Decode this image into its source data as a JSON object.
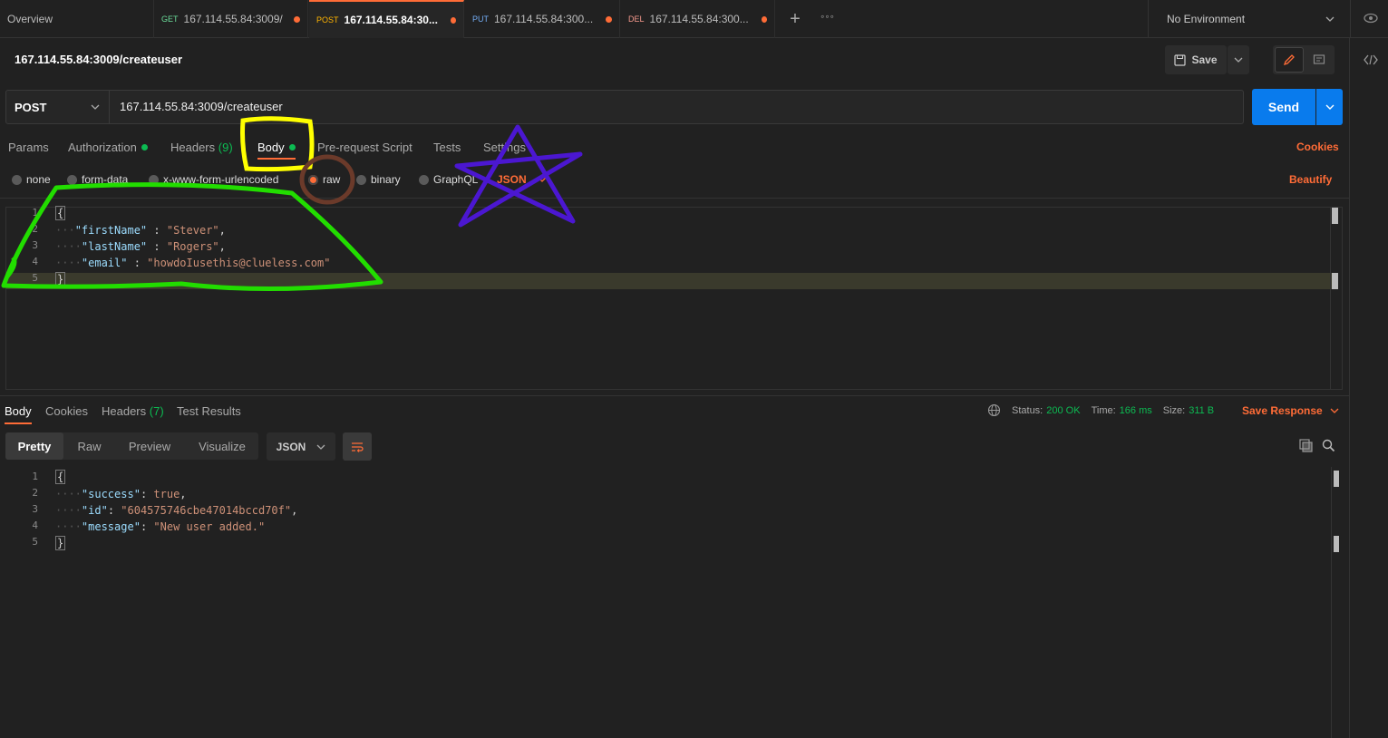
{
  "tabs": {
    "overview": "Overview",
    "items": [
      {
        "method": "GET",
        "url": "167.114.55.84:3009/"
      },
      {
        "method": "POST",
        "url": "167.114.55.84:30..."
      },
      {
        "method": "PUT",
        "url": "167.114.55.84:300..."
      },
      {
        "method": "DEL",
        "url": "167.114.55.84:300..."
      }
    ],
    "environment": "No Environment"
  },
  "request": {
    "title": "167.114.55.84:3009/createuser",
    "save_label": "Save",
    "method": "POST",
    "url": "167.114.55.84:3009/createuser",
    "send_label": "Send"
  },
  "req_tabs": {
    "params": "Params",
    "authorization": "Authorization",
    "headers": "Headers",
    "headers_count": "(9)",
    "body": "Body",
    "prerequest": "Pre-request Script",
    "tests": "Tests",
    "settings": "Settings",
    "cookies": "Cookies"
  },
  "body_types": {
    "none": "none",
    "formdata": "form-data",
    "urlencoded": "x-www-form-urlencoded",
    "raw": "raw",
    "binary": "binary",
    "graphql": "GraphQL",
    "format": "JSON",
    "beautify": "Beautify"
  },
  "request_body": {
    "lines": [
      "1",
      "2",
      "3",
      "4",
      "5"
    ],
    "open": "{",
    "close": "}",
    "k1": "\"firstName\"",
    "v1": "\"Stever\"",
    "k2": "\"lastName\"",
    "v2": "\"Rogers\"",
    "k3": "\"email\"",
    "v3": "\"howdoIusethis@clueless.com\""
  },
  "response": {
    "tabs": {
      "body": "Body",
      "cookies": "Cookies",
      "headers": "Headers",
      "headers_count": "(7)",
      "test_results": "Test Results"
    },
    "status_label": "Status:",
    "status_value": "200 OK",
    "time_label": "Time:",
    "time_value": "166 ms",
    "size_label": "Size:",
    "size_value": "311 B",
    "save_response": "Save Response",
    "views": {
      "pretty": "Pretty",
      "raw": "Raw",
      "preview": "Preview",
      "visualize": "Visualize",
      "format": "JSON"
    },
    "lines": [
      "1",
      "2",
      "3",
      "4",
      "5"
    ],
    "open": "{",
    "close": "}",
    "k1": "\"success\"",
    "v1": "true",
    "k2": "\"id\"",
    "v2": "\"604575746cbe47014bccd70f\"",
    "k3": "\"message\"",
    "v3": "\"New user added.\""
  },
  "colors": {
    "accent": "#ff6c37",
    "send": "#097bed",
    "success": "#0cbb52",
    "annotation_yellow": "#ffff00",
    "annotation_green": "#22dd00",
    "annotation_brown": "#6b3a2a",
    "annotation_purple": "#4b17d1"
  }
}
